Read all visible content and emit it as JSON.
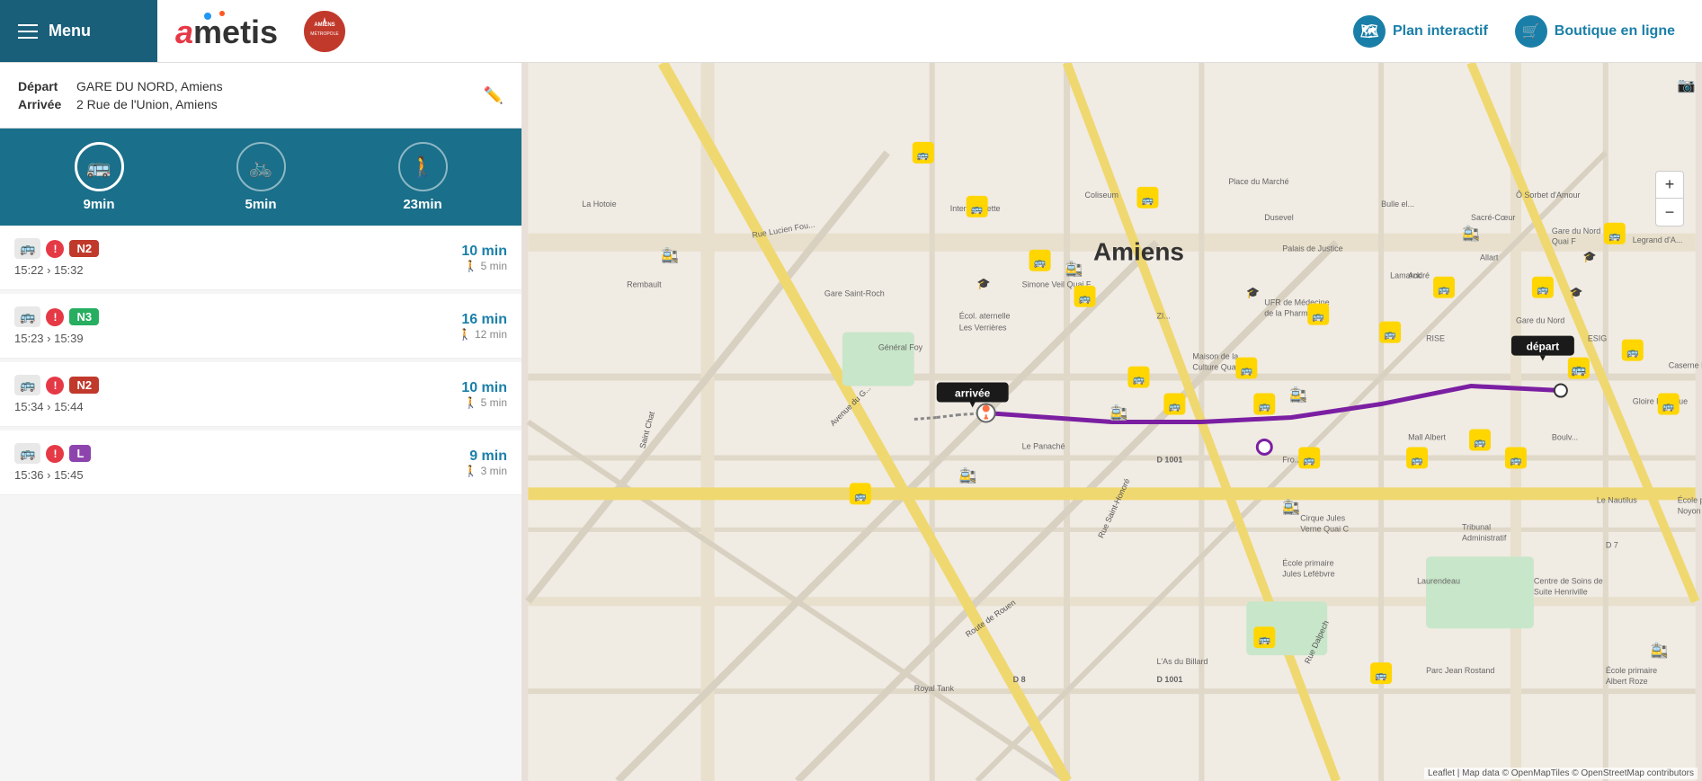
{
  "header": {
    "menu_label": "Menu",
    "logo_text": "ametis",
    "links": [
      {
        "id": "plan",
        "icon": "map-icon",
        "label": "Plan interactif"
      },
      {
        "id": "boutique",
        "icon": "cart-icon",
        "label": "Boutique en ligne"
      }
    ]
  },
  "journey": {
    "depart_label": "Départ",
    "depart_value": "GARE DU NORD, Amiens",
    "arrivee_label": "Arrivée",
    "arrivee_value": "2 Rue de l'Union, Amiens"
  },
  "transport_modes": [
    {
      "id": "bus",
      "icon": "🚌",
      "time": "9min",
      "active": true
    },
    {
      "id": "bike",
      "icon": "🚲",
      "time": "5min",
      "active": false
    },
    {
      "id": "walk",
      "icon": "🚶",
      "time": "23min",
      "active": false
    }
  ],
  "routes": [
    {
      "line": "N2",
      "badge_class": "badge-N2",
      "has_alert": true,
      "depart_time": "15:22",
      "arrive_time": "15:32",
      "duration": "10 min",
      "walk_time": "5 min"
    },
    {
      "line": "N3",
      "badge_class": "badge-N3",
      "has_alert": true,
      "depart_time": "15:23",
      "arrive_time": "15:39",
      "duration": "16 min",
      "walk_time": "12 min"
    },
    {
      "line": "N2",
      "badge_class": "badge-N2",
      "has_alert": true,
      "depart_time": "15:34",
      "arrive_time": "15:44",
      "duration": "10 min",
      "walk_time": "5 min"
    },
    {
      "line": "L",
      "badge_class": "badge-L",
      "has_alert": true,
      "depart_time": "15:36",
      "arrive_time": "15:45",
      "duration": "9 min",
      "walk_time": "3 min"
    }
  ],
  "map": {
    "label_arrivee": "arrivée",
    "label_depart": "départ",
    "zoom_in": "+",
    "zoom_out": "−",
    "attribution": "Leaflet | Map data © OpenMapTiles © OpenStreetMap contributors",
    "city_name": "Amiens"
  }
}
